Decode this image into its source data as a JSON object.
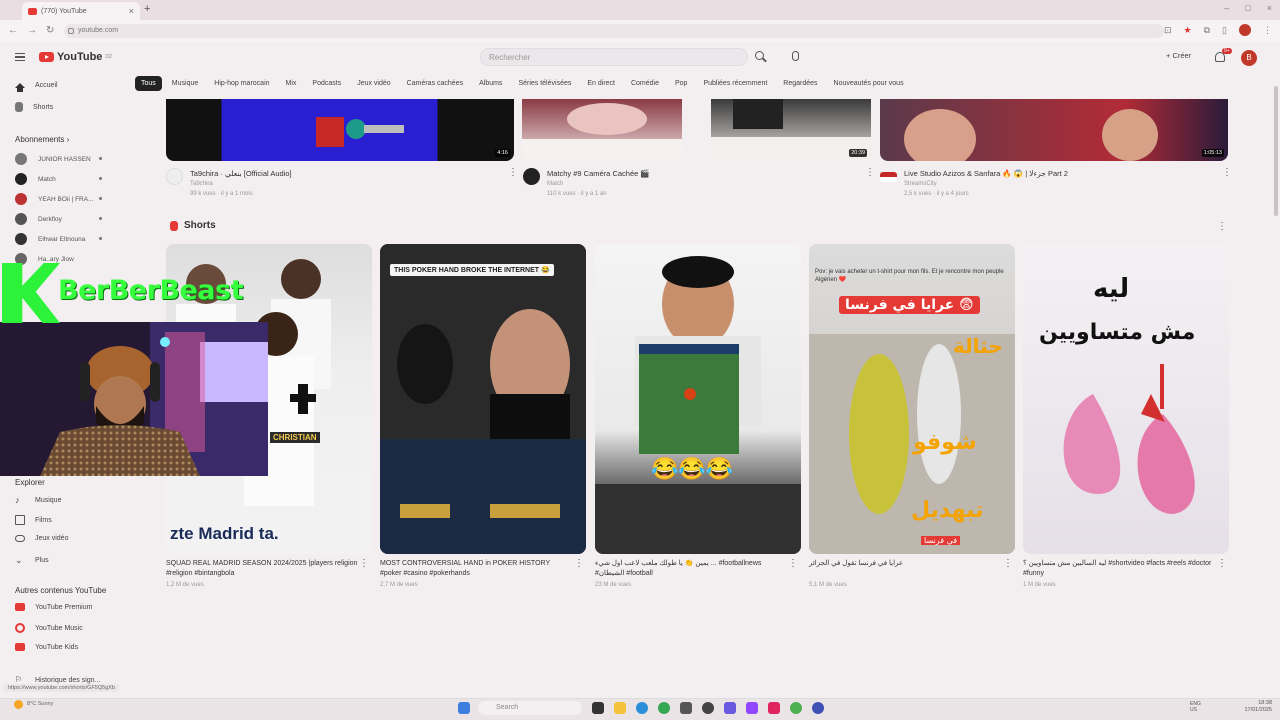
{
  "browser": {
    "tab_title": "(770) YouTube",
    "url": "youtube.com",
    "status_url": "https://www.youtube.com/shorts/GF5Q5gXb"
  },
  "header": {
    "logo_text": "YouTube",
    "logo_region": "DZ",
    "search_placeholder": "Rechercher",
    "create_label": "Créer",
    "notif_count": "9+",
    "avatar_letter": "B"
  },
  "chips": [
    "Tous",
    "Musique",
    "Hip-hop marocain",
    "Mix",
    "Podcasts",
    "Jeux vidéo",
    "Caméras cachées",
    "Albums",
    "Séries télévisées",
    "En direct",
    "Comédie",
    "Pop",
    "Publiées récemment",
    "Regardées",
    "Nouveautés pour vous"
  ],
  "sidebar": {
    "home": "Accueil",
    "shorts": "Shorts",
    "subs_title": "Abonnements",
    "subs": [
      "JUNIOR HASSEN",
      "Match",
      "YEAH BOii | FRA...",
      "Derkfloy",
      "Elhwar Eltnouna",
      "Ha..ary Jlow"
    ],
    "explore_title": "Explorer",
    "explore": [
      "Musique",
      "Films",
      "Jeux vidéo",
      "Plus"
    ],
    "other_title": "Autres contenus YouTube",
    "other": [
      "YouTube Premium",
      "YouTube Music",
      "YouTube Kids"
    ],
    "history": "Historique des sign..."
  },
  "videos": [
    {
      "title": "Ta9chira · بنعلي [Official Audio]",
      "channel": "Ta9chira",
      "views": "99 k vues · il y a 1 mois",
      "duration": "4:16"
    },
    {
      "title": "Matchy #9 Caméra Cachée 🎬",
      "channel": "Match",
      "views": "110 k vues · il y a 1 an",
      "duration": "20:39"
    },
    {
      "title": "Live Studio Azizos & Sanfara 🔥 😱 | جزءلا Part 2",
      "channel": "StreamsCity",
      "views": "2,5 k vues · il y a 4 jours",
      "duration": "1:05:13"
    }
  ],
  "shorts_section": {
    "title": "Shorts"
  },
  "shorts": [
    {
      "title": "SQUAD REAL MADRID SEASON 2024/2025 |players religion #religion #bintangbola",
      "views": "1,2 M de vues",
      "overlay": "zte Madrid ta.",
      "tag": "CHRISTIAN"
    },
    {
      "title": "MOST CONTROVERSIAL HAND in POKER HISTORY #poker #casino #pokerhands",
      "views": "2,7 M de vues",
      "overlay": "THIS POKER HAND BROKE THE INTERNET 😂"
    },
    {
      "title": "يمين 👏 يا طولك ملعب لاعب اول شيء ... #footballnews #الشيطان #football",
      "views": "23 M de vues",
      "overlay": "😂😂😂"
    },
    {
      "title": "عرايا في فرنسا تقول في الجزائر",
      "views": "5,1 M de vues",
      "overlay_top": "Pov: je vais acheter un t-shirt pour mon fils. Et je rencontre mon peuple Algérien ❤️",
      "overlay_banner": "عرايا في فرنسا 😨",
      "overlay_big": "حثالة",
      "overlay_mid": "شوفو",
      "overlay_low": "تبهديل",
      "overlay_tag": "في فرنسا"
    },
    {
      "title": "ليه السالبين مش متساويين ؟ #shortvideo #facts #reels #doctor #funny",
      "views": "1 M de vues",
      "overlay_top": "ليه",
      "overlay_bottom": "مش متساويين"
    }
  ],
  "streamer": {
    "brand": "BerBerBeast"
  },
  "taskbar": {
    "search": "Search",
    "time": "18:38",
    "date": "17/01/2025",
    "weather": "8°C Sunny",
    "lang": "ENG US"
  }
}
